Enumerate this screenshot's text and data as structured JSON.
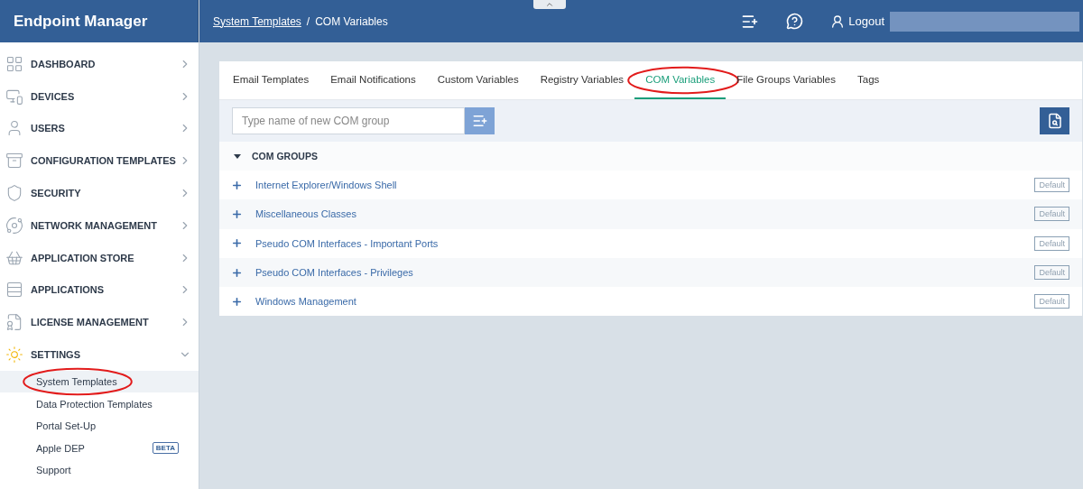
{
  "app": {
    "title": "Endpoint Manager"
  },
  "sidebar": {
    "items": [
      {
        "label": "DASHBOARD",
        "expanded": false
      },
      {
        "label": "DEVICES",
        "expanded": false
      },
      {
        "label": "USERS",
        "expanded": false
      },
      {
        "label": "CONFIGURATION TEMPLATES",
        "expanded": false
      },
      {
        "label": "SECURITY",
        "expanded": false
      },
      {
        "label": "NETWORK MANAGEMENT",
        "expanded": false
      },
      {
        "label": "APPLICATION STORE",
        "expanded": false
      },
      {
        "label": "APPLICATIONS",
        "expanded": false
      },
      {
        "label": "LICENSE MANAGEMENT",
        "expanded": false
      },
      {
        "label": "SETTINGS",
        "expanded": true,
        "children": [
          {
            "label": "System Templates",
            "selected": true,
            "circled": true
          },
          {
            "label": "Data Protection Templates",
            "selected": false,
            "circled": false
          },
          {
            "label": "Portal Set-Up",
            "selected": false,
            "circled": false
          },
          {
            "label": "Apple DEP",
            "selected": false,
            "circled": false,
            "badge": "BETA"
          },
          {
            "label": "Support",
            "selected": false,
            "circled": false
          }
        ]
      }
    ]
  },
  "header": {
    "breadcrumb": [
      {
        "label": "System Templates",
        "link": true
      },
      {
        "label": "/",
        "link": false
      },
      {
        "label": "COM Variables",
        "link": false
      }
    ],
    "logout": "Logout"
  },
  "tabs": [
    {
      "label": "Email Templates",
      "selected": false,
      "circled": false
    },
    {
      "label": "Email Notifications",
      "selected": false,
      "circled": false
    },
    {
      "label": "Custom Variables",
      "selected": false,
      "circled": false
    },
    {
      "label": "Registry Variables",
      "selected": false,
      "circled": false
    },
    {
      "label": "COM Variables",
      "selected": true,
      "circled": true
    },
    {
      "label": "File Groups Variables",
      "selected": false,
      "circled": false
    },
    {
      "label": "Tags",
      "selected": false,
      "circled": false
    }
  ],
  "new_group": {
    "placeholder": "Type name of new COM group"
  },
  "groups": {
    "title": "COM GROUPS",
    "expanded": true,
    "rows": [
      {
        "name": "Internet Explorer/Windows Shell",
        "tag": "Default"
      },
      {
        "name": "Miscellaneous Classes",
        "tag": "Default"
      },
      {
        "name": "Pseudo COM Interfaces - Important Ports",
        "tag": "Default"
      },
      {
        "name": "Pseudo COM Interfaces - Privileges",
        "tag": "Default"
      },
      {
        "name": "Windows Management",
        "tag": "Default"
      }
    ]
  }
}
